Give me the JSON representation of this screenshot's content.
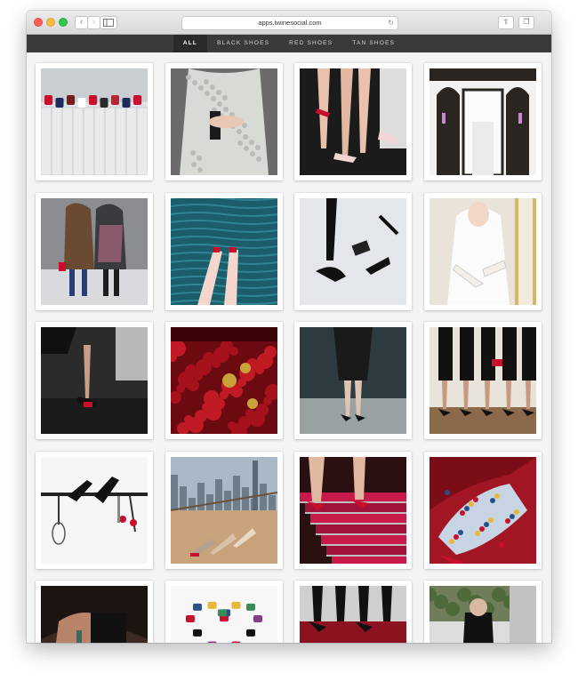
{
  "browser": {
    "url": "apps.twinesocial.com",
    "back_icon": "chevron-left-icon",
    "forward_icon": "chevron-right-icon",
    "reload_icon": "reload-icon",
    "share_icon": "share-icon",
    "tabs_icon": "tabs-icon",
    "newtab_icon": "plus-icon"
  },
  "nav": {
    "items": [
      {
        "label": "ALL",
        "active": true
      },
      {
        "label": "BLACK SHOES",
        "active": false
      },
      {
        "label": "RED SHOES",
        "active": false
      },
      {
        "label": "TAN SHOES",
        "active": false
      }
    ]
  },
  "gallery": {
    "accent": "#c8102e",
    "rows": 5,
    "cols": 4
  }
}
